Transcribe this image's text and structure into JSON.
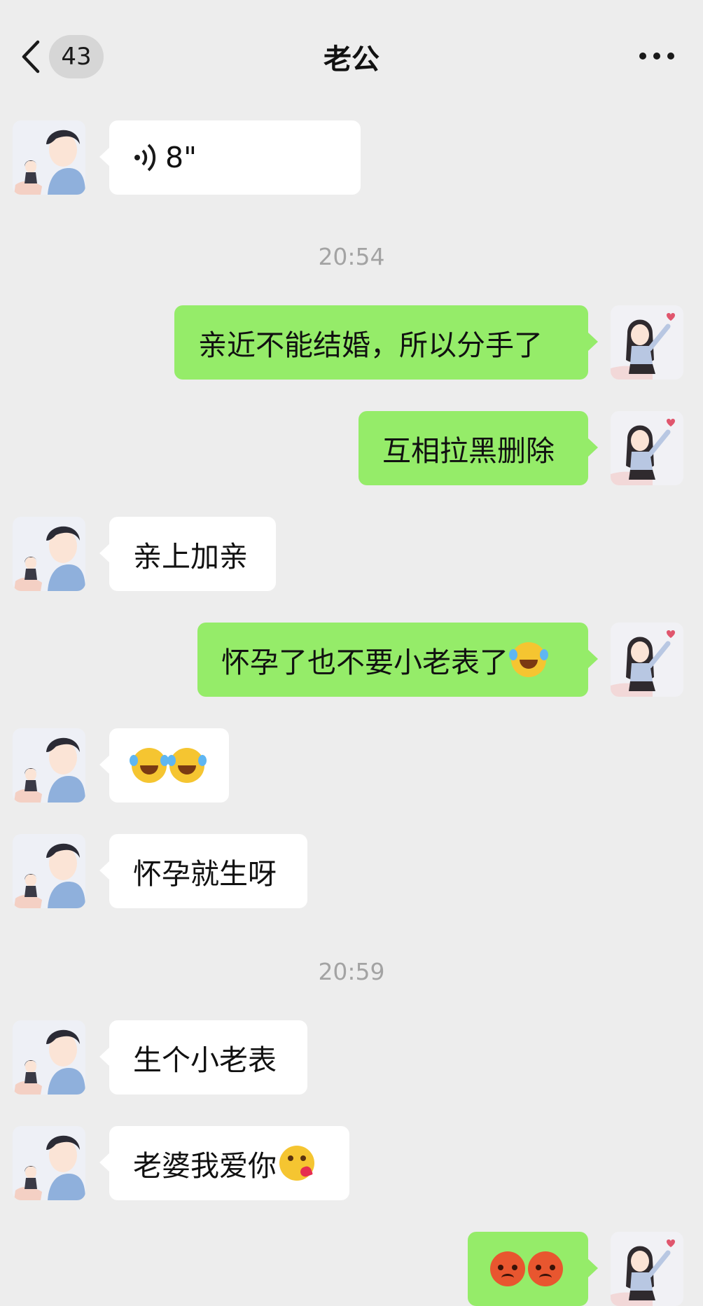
{
  "header": {
    "back_icon": "chevron-left-icon",
    "unread_count": "43",
    "title": "老公",
    "more_icon": "more-dots-icon"
  },
  "messages": [
    {
      "type": "voice",
      "side": "left",
      "duration": "8\""
    },
    {
      "type": "time",
      "text": "20:54"
    },
    {
      "type": "text",
      "side": "right",
      "text": "亲近不能结婚，所以分手了"
    },
    {
      "type": "text",
      "side": "right",
      "text": "互相拉黑删除"
    },
    {
      "type": "text",
      "side": "left",
      "text": "亲上加亲"
    },
    {
      "type": "text",
      "side": "right",
      "text": "怀孕了也不要小老表了",
      "emoji": "laugh-cry-emoji"
    },
    {
      "type": "emoji",
      "side": "left",
      "emojis": [
        "laugh-cry-emoji",
        "laugh-cry-emoji"
      ]
    },
    {
      "type": "text",
      "side": "left",
      "text": "怀孕就生呀"
    },
    {
      "type": "time",
      "text": "20:59"
    },
    {
      "type": "text",
      "side": "left",
      "text": "生个小老表"
    },
    {
      "type": "text",
      "side": "left",
      "text": "老婆我爱你",
      "emoji": "kiss-emoji"
    },
    {
      "type": "emoji",
      "side": "right",
      "emojis": [
        "sad-red-face-emoji",
        "sad-red-face-emoji"
      ]
    }
  ],
  "colors": {
    "background": "#ededed",
    "outgoing_bubble": "#95ec69",
    "incoming_bubble": "#ffffff",
    "timestamp_text": "#a3a3a3"
  }
}
